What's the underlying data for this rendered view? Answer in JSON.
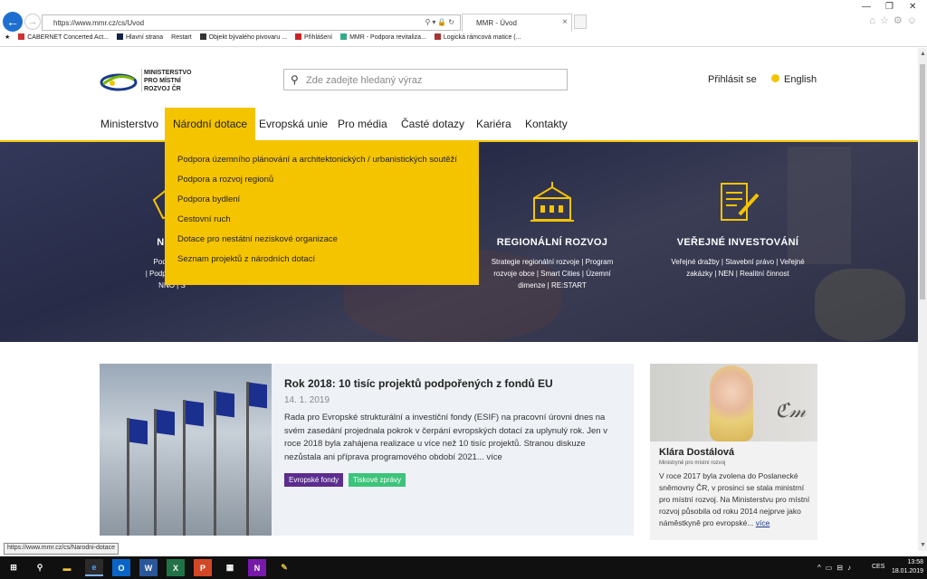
{
  "browser": {
    "url": "https://www.mmr.cz/cs/Uvod",
    "tab_title": "MMR - Úvod",
    "favorites": [
      "CABERNET Concerted Act...",
      "Hlavní strana",
      "Restart",
      "Objekt bývalého pivovaru ...",
      "Přihlášení",
      "MMR - Podpora revitaliza...",
      "Logická rámcová matice (..."
    ],
    "status_url": "https://www.mmr.cz/cs/Narodni-dotace"
  },
  "header": {
    "logo_lines": [
      "MINISTERSTVO",
      "PRO MÍSTNÍ",
      "ROZVOJ ČR"
    ],
    "search_placeholder": "Zde zadejte hledaný výraz",
    "login": "Přihlásit se",
    "language": "English"
  },
  "nav": [
    "Ministerstvo",
    "Národní dotace",
    "Evropská unie",
    "Pro média",
    "Časté dotazy",
    "Kariéra",
    "Kontakty"
  ],
  "dropdown": [
    "Podpora územního plánování a architektonických / urbanistických soutěží",
    "Podpora a rozvoj regionů",
    "Podpora bydlení",
    "Cestovní ruch",
    "Dotace pro nestátní neziskové organizace",
    "Seznam projektů z národních dotací"
  ],
  "hero": {
    "col1": {
      "heading": "NÁRO",
      "lines": [
        "Podpora by",
        "| Podpora a rozv",
        "NNO | S"
      ]
    },
    "col2": {
      "heading": "REGIONÁLNÍ ROZVOJ",
      "lines": [
        "Strategie regionální rozvoje | Program",
        "rozvoje obce | Smart Cities | Územní",
        "dimenze | RE:START"
      ]
    },
    "col3": {
      "heading": "VEŘEJNÉ INVESTOVÁNÍ",
      "lines": [
        "Veřejné dražby | Stavební právo | Veřejné",
        "zakázky | NEN | Realitní činnost"
      ]
    }
  },
  "news": {
    "title": "Rok 2018: 10 tisíc projektů podpořených z fondů EU",
    "date": "14. 1. 2019",
    "body": "Rada pro Evropské strukturální a investiční fondy (ESIF) na pracovní úrovni dnes na svém zasedání projednala pokrok v čerpání evropských dotací za uplynulý rok. Jen v roce 2018 byla zahájena realizace u více než 10 tisíc projektů. Stranou diskuze nezůstala ani příprava programového období 2021... více",
    "badges": [
      "Evropské fondy",
      "Tiskové zprávy"
    ]
  },
  "minister": {
    "name": "Klára Dostálová",
    "role": "Ministryně pro místní rozvoj",
    "bio": "V roce 2017 byla zvolena do Poslanecké sněmovny ČR, v prosinci se stala ministrní pro místní rozvoj. Na Ministerstvu pro místní rozvoj působila od roku 2014 nejprve jako náměstkyně pro evropské...",
    "more": "více"
  },
  "taskbar": {
    "lang": "CES",
    "time": "13:58",
    "date": "18.01.2019"
  }
}
